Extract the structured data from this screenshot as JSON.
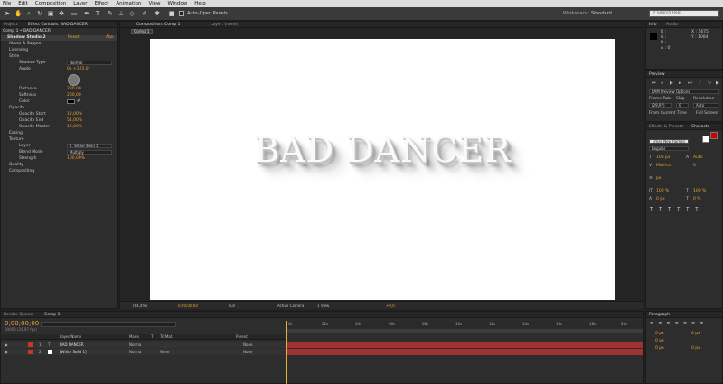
{
  "menu": [
    "File",
    "Edit",
    "Composition",
    "Layer",
    "Effect",
    "Animation",
    "View",
    "Window",
    "Help"
  ],
  "toolbar": {
    "auto_open": "Auto-Open Panels",
    "workspace_label": "Workspace:",
    "workspace_value": "Standard",
    "search_placeholder": "Search Help"
  },
  "project": {
    "tab_project": "Project",
    "tab_effects": "Effect Controls: BAD DANCER",
    "breadcrumb": "Comp 1 • BAD DANCER",
    "effect_name": "Shadow Studio 2",
    "reset": "Reset",
    "about": "Abo",
    "rows": [
      "About & Support",
      "Licensing",
      "Style",
      "Shadow Type",
      "Angle",
      "Distance",
      "Softness",
      "Color",
      "Opacity",
      "Opacity Start",
      "Opacity End",
      "Opacity Master",
      "Easing",
      "Texture",
      "Layer",
      "Blend Mode",
      "Strength",
      "Quality",
      "Compositing"
    ],
    "values": {
      "shadow_type": "Normal",
      "angle": "0x +125.0°",
      "distance": "230,00",
      "softness": "200,00",
      "opacity_start": "12,00%",
      "opacity_end": "51,00%",
      "opacity_master": "16,00%",
      "layer": "2. White Solid 1",
      "blend_mode": "Multiply",
      "strength": "100,00%"
    }
  },
  "composition": {
    "tab_comp": "Composition: Comp 1",
    "tab_layer": "Layer: (none)",
    "sub_tab": "Comp 1",
    "title": "BAD DANCER",
    "footer": {
      "zoom": "(64,4%)",
      "time": "0;00;00;00",
      "quality": "Full",
      "camera": "Active Camera",
      "views": "1 View",
      "exposure": "+0,0"
    }
  },
  "info": {
    "tab_info": "Info",
    "tab_audio": "Audio",
    "lines": [
      "R :",
      "G :",
      "B :",
      "A : 0"
    ],
    "coords": [
      "X : 1675",
      "Y : 1084"
    ]
  },
  "preview": {
    "tab": "Preview",
    "ram": "RAM Preview Options",
    "frame_rate_lbl": "Frame Rate",
    "skip_lbl": "Skip",
    "resolution_lbl": "Resolution",
    "frame_rate": "(29,97)",
    "skip": "0",
    "resolution": "Auto",
    "from_current": "From Current Time",
    "full_screen": "Full Screen"
  },
  "effects_presets": {
    "tab": "Effects & Presets",
    "tab_char": "Characte"
  },
  "character": {
    "font": "Times New Roman",
    "style": "Regular",
    "size": "103 px",
    "leading": "Auto",
    "tracking": "Metrics",
    "kern": "0",
    "vscale": "100 %",
    "hscale": "100 %",
    "baseline": "0 px",
    "tsume": "0 %"
  },
  "paragraph": {
    "tab": "Paragraph",
    "values": [
      "0 px",
      "0 px",
      "0 px",
      "0 px",
      "0 px"
    ]
  },
  "timeline": {
    "tab_render": "Render Queue",
    "tab_comp": "Comp 1",
    "time": "0;00;00;00",
    "fps": "00000 (29.97 fps)",
    "col_layer": "Layer Name",
    "col_mode": "Mode",
    "col_t": "T",
    "col_trkmat": "TrkMat",
    "col_parent": "Parent",
    "layers": [
      {
        "num": "1",
        "name": "BAD DANCER",
        "mode": "Norma",
        "trk": "",
        "parent": "None"
      },
      {
        "num": "2",
        "name": "[White Solid 1]",
        "mode": "Norma",
        "trk": "None",
        "parent": "None"
      }
    ],
    "ticks": [
      "0s",
      "02s",
      "04s",
      "06s",
      "08s",
      "10s",
      "12s",
      "14s",
      "16s",
      "18s",
      "20s"
    ]
  }
}
